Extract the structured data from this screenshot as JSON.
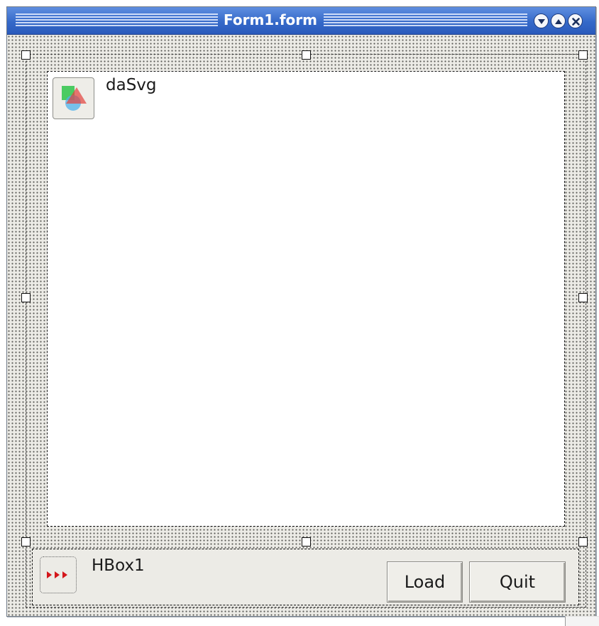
{
  "window": {
    "title": "Form1.form",
    "controls": {
      "minimize_icon": "triangle-down-icon",
      "maximize_icon": "triangle-up-icon",
      "close_icon": "close-x-icon"
    }
  },
  "form": {
    "svg_control": {
      "name": "daSvg",
      "icon": "svg-shapes-icon"
    },
    "hbox": {
      "name": "HBox1",
      "icon": "hbox-arrows-icon",
      "buttons": {
        "load_label": "Load",
        "quit_label": "Quit"
      }
    }
  },
  "colors": {
    "titlebar": "#3569c9",
    "client_background": "#ecebe6",
    "hbox_icon_arrows": "#d4161b"
  }
}
